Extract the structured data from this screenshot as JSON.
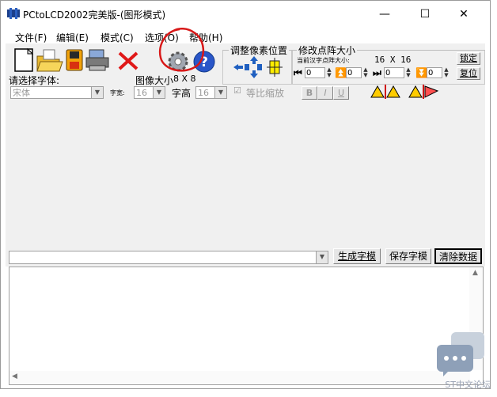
{
  "title_bar": {
    "title": "PCtoLCD2002完美版-(图形模式)",
    "minimize": "—",
    "maximize": "☐",
    "close": "✕"
  },
  "menu": [
    {
      "label": "文件(F)"
    },
    {
      "label": "编辑(E)"
    },
    {
      "label": "模式(C)"
    },
    {
      "label": "选项(O)"
    },
    {
      "label": "帮助(H)"
    }
  ],
  "toolbar": {
    "icons": [
      "new-file-icon",
      "open-folder-icon",
      "save-icon",
      "print-icon",
      "delete-x-icon",
      "settings-gear-icon",
      "help-icon"
    ]
  },
  "font_row": {
    "font_label": "请选择字体:",
    "font_value": "宋体",
    "image_size_label": "图像大小",
    "image_size_value": "8 X 8",
    "char_width_label": "字宽:",
    "char_width_value": "16",
    "char_height_label": "字高",
    "char_height_value": "16",
    "proportional_label": "等比缩放",
    "bold": "B",
    "italic": "I",
    "underline": "U"
  },
  "pixel_adjust": {
    "title": "调整像素位置"
  },
  "dot_size": {
    "title": "修改点阵大小",
    "current_label": "当前汉字点阵大小:",
    "current_value": "16 X 16",
    "lock_button": "锁定",
    "reset_button": "复位",
    "spin_values": [
      "0",
      "0",
      "0",
      "0"
    ]
  },
  "bottom_controls": {
    "generate_button": "生成字模",
    "save_button": "保存字模",
    "clear_button": "清除数据"
  },
  "annotation": {
    "color": "#d81818"
  },
  "watermark": "ST中文论坛"
}
